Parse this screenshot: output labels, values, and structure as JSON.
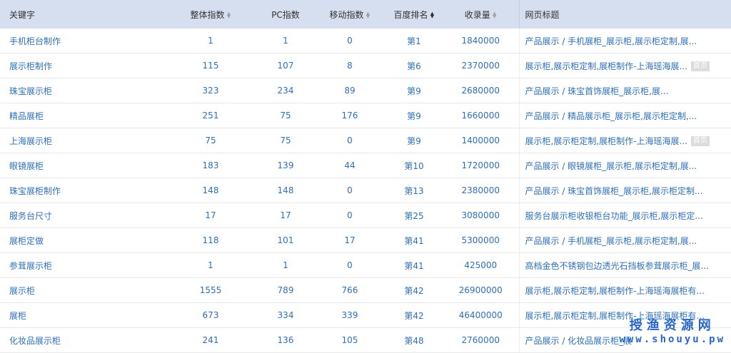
{
  "headers": {
    "keyword": "关键字",
    "overall": "整体指数",
    "pc": "PC指数",
    "mobile": "移动指数",
    "rank": "百度排名",
    "indexed": "收录量",
    "title": "网页标题"
  },
  "sort_glyph": {
    "up": "▲",
    "down": "▼"
  },
  "rows": [
    {
      "keyword": "手机柜台制作",
      "overall": "1",
      "pc": "1",
      "mobile": "0",
      "rank": "第1",
      "indexed": "1840000",
      "title": "产品展示 / 手机展柜_展示柜,展示柜定制,展...",
      "badge": ""
    },
    {
      "keyword": "展示柜制作",
      "overall": "115",
      "pc": "107",
      "mobile": "8",
      "rank": "第6",
      "indexed": "2370000",
      "title": "展示柜,展示柜定制,展柜制作-上海瑶海展...",
      "badge": "首页"
    },
    {
      "keyword": "珠宝展示柜",
      "overall": "323",
      "pc": "234",
      "mobile": "89",
      "rank": "第9",
      "indexed": "2680000",
      "title": "产品展示 / 珠宝首饰展柜_展示柜,展...",
      "badge": ""
    },
    {
      "keyword": "精品展柜",
      "overall": "251",
      "pc": "75",
      "mobile": "176",
      "rank": "第9",
      "indexed": "1660000",
      "title": "产品展示 / 精品展示柜_展示柜,展示柜定制,...",
      "badge": ""
    },
    {
      "keyword": "上海展示柜",
      "overall": "75",
      "pc": "75",
      "mobile": "0",
      "rank": "第9",
      "indexed": "1400000",
      "title": "展示柜,展示柜定制,展柜制作-上海瑶海展...",
      "badge": "首页"
    },
    {
      "keyword": "眼镜展柜",
      "overall": "183",
      "pc": "139",
      "mobile": "44",
      "rank": "第10",
      "indexed": "1720000",
      "title": "产品展示 / 眼镜展柜_展示柜,展示柜定制,展...",
      "badge": ""
    },
    {
      "keyword": "珠宝展柜制作",
      "overall": "148",
      "pc": "148",
      "mobile": "0",
      "rank": "第13",
      "indexed": "2380000",
      "title": "产品展示 / 珠宝首饰展柜_展示柜,展示柜定制...",
      "badge": ""
    },
    {
      "keyword": "服务台尺寸",
      "overall": "17",
      "pc": "17",
      "mobile": "0",
      "rank": "第25",
      "indexed": "3080000",
      "title": "服务台展示柜收银柜台功能_展示柜,展示柜定...",
      "badge": ""
    },
    {
      "keyword": "展柜定做",
      "overall": "118",
      "pc": "101",
      "mobile": "17",
      "rank": "第41",
      "indexed": "5300000",
      "title": "产品展示 / 手机展柜_展示柜,展示柜定制,展...",
      "badge": ""
    },
    {
      "keyword": "参茸展示柜",
      "overall": "1",
      "pc": "1",
      "mobile": "0",
      "rank": "第41",
      "indexed": "425000",
      "title": "高档金色不锈钢包边透光石挡板参茸展示柜_展...",
      "badge": ""
    },
    {
      "keyword": "展示柜",
      "overall": "1555",
      "pc": "789",
      "mobile": "766",
      "rank": "第42",
      "indexed": "26900000",
      "title": "展示柜,展示柜定制,展柜制作-上海瑶海展柜有...",
      "badge": ""
    },
    {
      "keyword": "展柜",
      "overall": "673",
      "pc": "334",
      "mobile": "339",
      "rank": "第42",
      "indexed": "46400000",
      "title": "展示柜,展示柜定制,展柜制作-上海瑶海展柜有...",
      "badge": ""
    },
    {
      "keyword": "化妆品展示柜",
      "overall": "241",
      "pc": "136",
      "mobile": "105",
      "rank": "第48",
      "indexed": "2760000",
      "title": "产品展示 / 化妆品展示柜_展",
      "badge": ""
    }
  ],
  "watermark": {
    "cn": "授渔资源网",
    "en": "www.shouyu.pw"
  }
}
